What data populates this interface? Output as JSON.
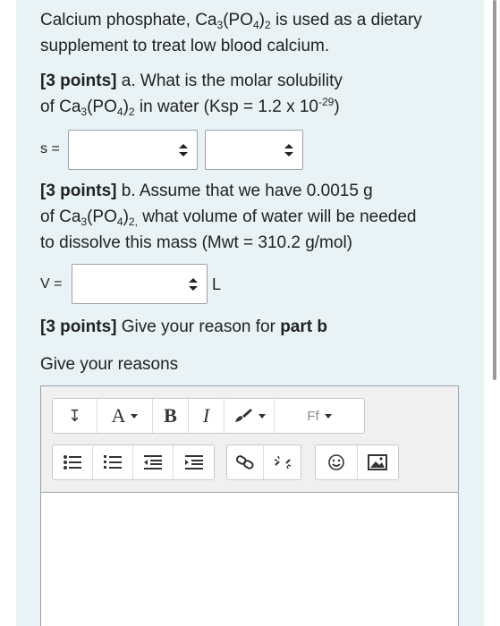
{
  "question": {
    "intro_line1": "Calcium phosphate, Ca",
    "intro_sub1": "3",
    "intro_mid1": "(PO",
    "intro_sub2": "4",
    "intro_end1": ")",
    "intro_sub3": "2",
    "intro_tail1": " is used as a dietary",
    "intro_line2": "supplement to treat low blood calcium."
  },
  "part_a": {
    "points": "[3 points]",
    "text1": " a. What is the molar solubility",
    "text2a": "of Ca",
    "sub1": "3",
    "text2b": "(PO",
    "sub2": "4",
    "text2c": ")",
    "sub3": "2",
    "text2d": " in water (Ksp = 1.2 x 10",
    "sup1": "-29",
    "text2e": ")",
    "answer_label": "s =",
    "value_select": "",
    "unit_select": ""
  },
  "part_b": {
    "points": "[3 points]",
    "text1": " b. Assume that we have 0.0015 g",
    "text2a": "of Ca",
    "sub1": "3",
    "text2b": "(PO",
    "sub2": "4",
    "text2c": ")",
    "sub3": "2,",
    "text2d": " what volume of water will be needed",
    "text3": "to dissolve this mass (Mwt = 310.2 g/mol)",
    "answer_label": "V =",
    "value_select": "",
    "unit": "L"
  },
  "part_c": {
    "points": "[3 points]",
    "text1": "  Give your reason for ",
    "bold": "part b",
    "prompt": "Give your reasons"
  },
  "toolbar": {
    "expand_icon": "↧",
    "font_color_label": "A",
    "bold_label": "B",
    "italic_label": "I",
    "font_family_label": "Ff"
  },
  "editor": {
    "content": ""
  }
}
